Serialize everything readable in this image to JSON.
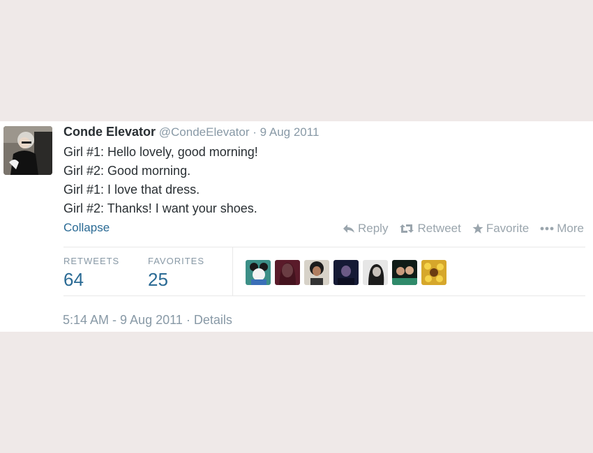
{
  "tweet": {
    "author_name": "Conde Elevator",
    "author_handle": "@CondeElevator",
    "separator": "·",
    "date": "9 Aug 2011",
    "lines": [
      "Girl #1: Hello lovely, good morning!",
      "Girl #2: Good morning.",
      "Girl #1: I love that dress.",
      "Girl #2: Thanks! I want your shoes."
    ],
    "collapse_label": "Collapse"
  },
  "actions": {
    "reply": "Reply",
    "retweet": "Retweet",
    "favorite": "Favorite",
    "more": "More"
  },
  "stats": {
    "retweets_label": "RETWEETS",
    "retweets_value": "64",
    "favorites_label": "FAVORITES",
    "favorites_value": "25"
  },
  "meta": {
    "timestamp": "5:14 AM - 9 Aug 2011",
    "separator": "·",
    "details_label": "Details"
  },
  "colors": {
    "page_background": "#efe9e8",
    "link_blue": "#2a6a94",
    "muted_gray": "#8899a6"
  }
}
